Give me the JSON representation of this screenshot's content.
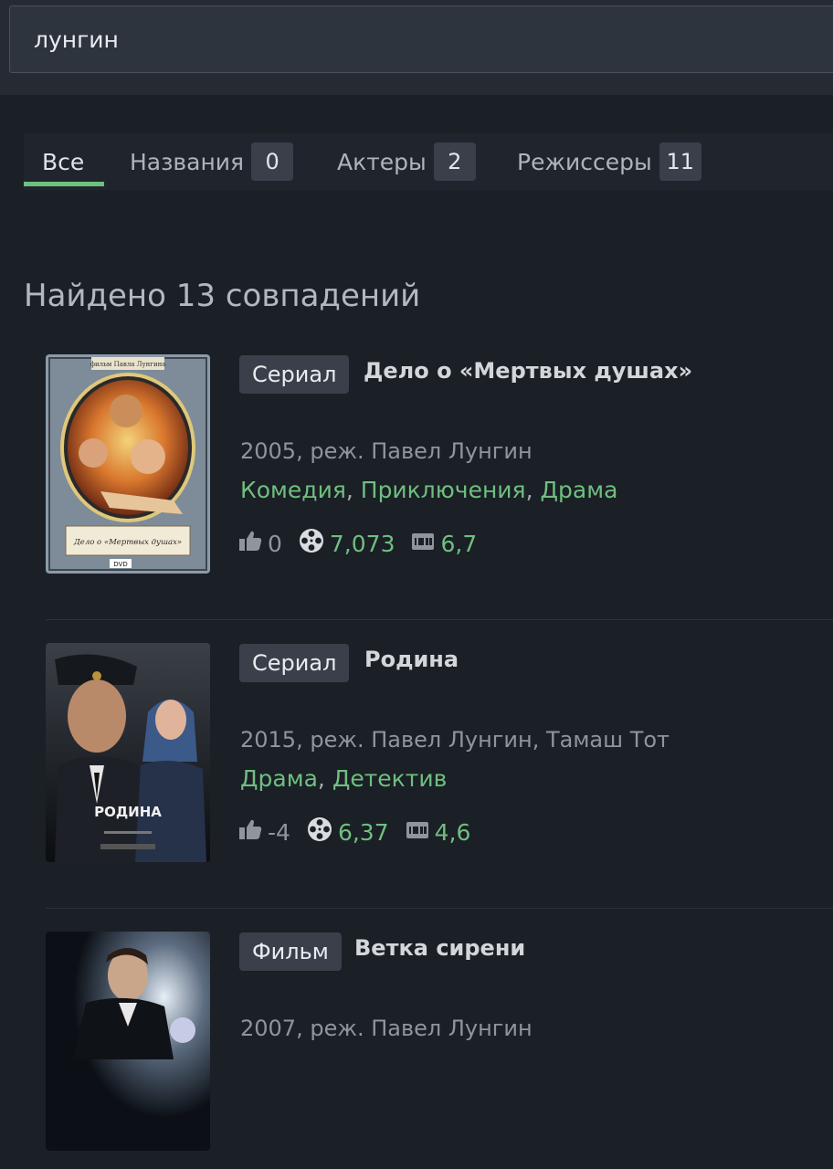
{
  "search": {
    "value": "лунгин"
  },
  "tabs": [
    {
      "label": "Все"
    },
    {
      "label": "Названия",
      "count": "0"
    },
    {
      "label": "Актеры",
      "count": "2"
    },
    {
      "label": "Режиссеры",
      "count": "11"
    }
  ],
  "results_heading": "Найдено 13 совпадений",
  "results": [
    {
      "type": "Сериал",
      "title": "Дело о «Мертвых душах»",
      "meta": "2005, реж. Павел Лунгин",
      "genres": [
        "Комедия",
        "Приключения",
        "Драма"
      ],
      "likes": "0",
      "kp_rating": "7,073",
      "imdb_rating": "6,7",
      "poster": {
        "top_text": "фильм Павла Лунгина",
        "title_text": "Дело о «Мертвых душах»",
        "corner_text": "DVD"
      }
    },
    {
      "type": "Сериал",
      "title": "Родина",
      "meta": "2015, реж. Павел Лунгин, Тамаш Тот",
      "genres": [
        "Драма",
        "Детектив"
      ],
      "likes": "-4",
      "kp_rating": "6,37",
      "imdb_rating": "4,6",
      "poster": {
        "title_text": "РОДИНА"
      }
    },
    {
      "type": "Фильм",
      "title": "Ветка сирени",
      "meta": "2007, реж. Павел Лунгин"
    }
  ],
  "colors": {
    "background": "#1b1f26",
    "accent_green": "#6fbf7f",
    "badge_bg": "#3a404a"
  },
  "icons": {
    "likes": "thumbs-up-icon",
    "kinopoisk": "film-reel-icon",
    "imdb": "imdb-icon"
  }
}
